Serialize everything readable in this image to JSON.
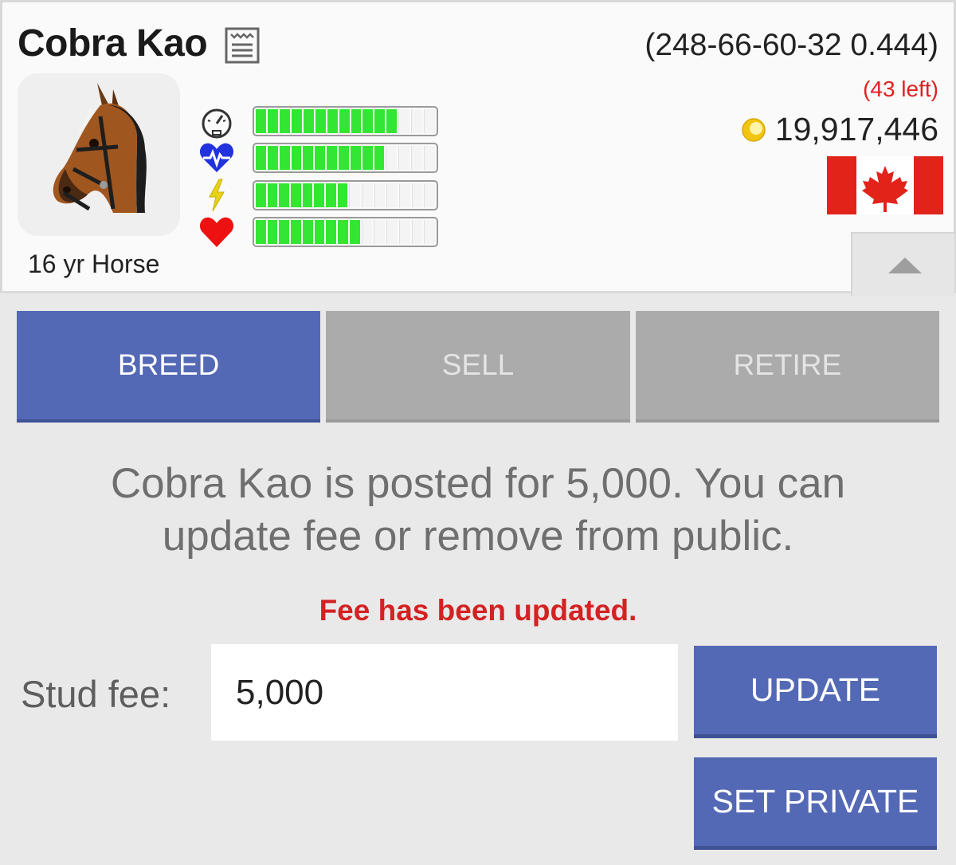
{
  "horse": {
    "name": "Cobra Kao",
    "age_label": "16 yr Horse",
    "record": "(248-66-60-32 0.444)"
  },
  "account": {
    "left_count": "(43 left)",
    "balance": "19,917,446",
    "country_flag": "canada-flag"
  },
  "stats": [
    {
      "icon": "speedometer-icon",
      "level": 0.8
    },
    {
      "icon": "heartbeat-icon",
      "level": 0.75
    },
    {
      "icon": "lightning-icon",
      "level": 0.55
    },
    {
      "icon": "heart-icon",
      "level": 0.62
    }
  ],
  "tabs": [
    {
      "label": "BREED",
      "active": true
    },
    {
      "label": "SELL",
      "active": false
    },
    {
      "label": "RETIRE",
      "active": false
    }
  ],
  "breed": {
    "message": "Cobra Kao is posted for 5,000. You can update fee or remove from public.",
    "status": "Fee has been updated.",
    "fee_label": "Stud fee:",
    "fee_value": "5,000",
    "update_label": "UPDATE",
    "set_private_label": "SET PRIVATE"
  },
  "colors": {
    "accent": "#5469b5",
    "inactive_tab": "#ababab",
    "bar_fill": "#33e633",
    "status_red": "#d32222"
  }
}
